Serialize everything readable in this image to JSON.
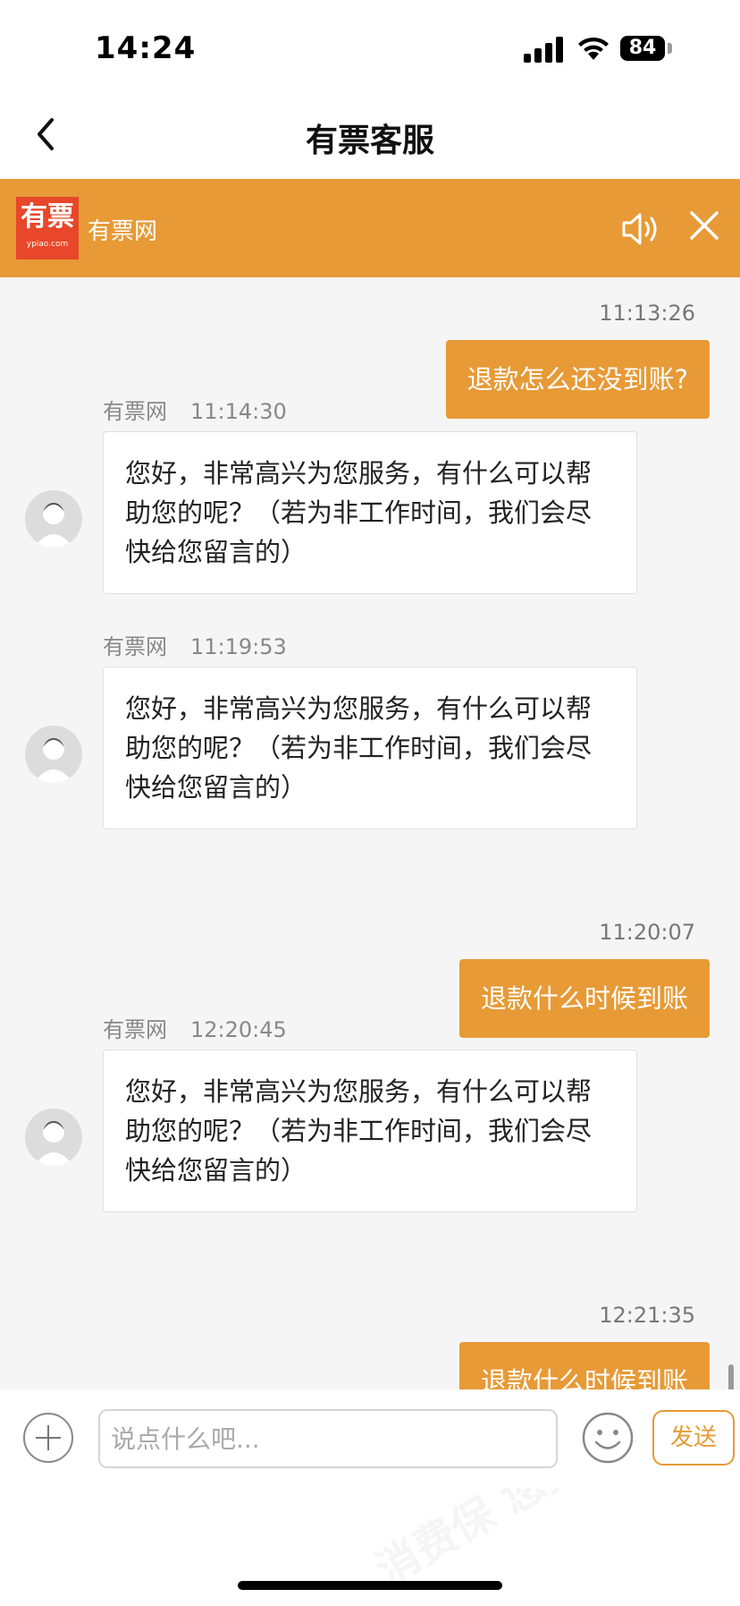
{
  "status_bar": {
    "time": "14:24",
    "battery": "84"
  },
  "nav": {
    "title": "有票客服"
  },
  "banner": {
    "logo_text": "有票",
    "logo_sub": "ypiao.com",
    "name": "有票网"
  },
  "messages": [
    {
      "side": "right",
      "time": "11:13:26",
      "text": "退款怎么还没到账?"
    },
    {
      "side": "left",
      "sender": "有票网",
      "time": "11:14:30",
      "text": "您好，非常高兴为您服务，有什么可以帮助您的呢？（若为非工作时间，我们会尽快给您留言的）"
    },
    {
      "side": "left",
      "sender": "有票网",
      "time": "11:19:53",
      "text": "您好，非常高兴为您服务，有什么可以帮助您的呢？（若为非工作时间，我们会尽快给您留言的）"
    },
    {
      "side": "right",
      "time": "11:20:07",
      "text": "退款什么时候到账"
    },
    {
      "side": "left",
      "sender": "有票网",
      "time": "12:20:45",
      "text": "您好，非常高兴为您服务，有什么可以帮助您的呢？（若为非工作时间，我们会尽快给您留言的）"
    },
    {
      "side": "right",
      "time": "12:21:35",
      "text": "退款什么时候到账"
    }
  ],
  "input": {
    "placeholder": "说点什么吧...",
    "send_label": "发送"
  },
  "watermark": {
    "text": "消费保 您身边的消费服务管家"
  },
  "colors": {
    "accent": "#e79a36",
    "logo_red": "#e8472a",
    "chat_bg": "#f5f5f5"
  },
  "icons": [
    "back-chevron-icon",
    "sound-icon",
    "close-icon",
    "plus-icon",
    "emoji-icon",
    "avatar-icon"
  ]
}
